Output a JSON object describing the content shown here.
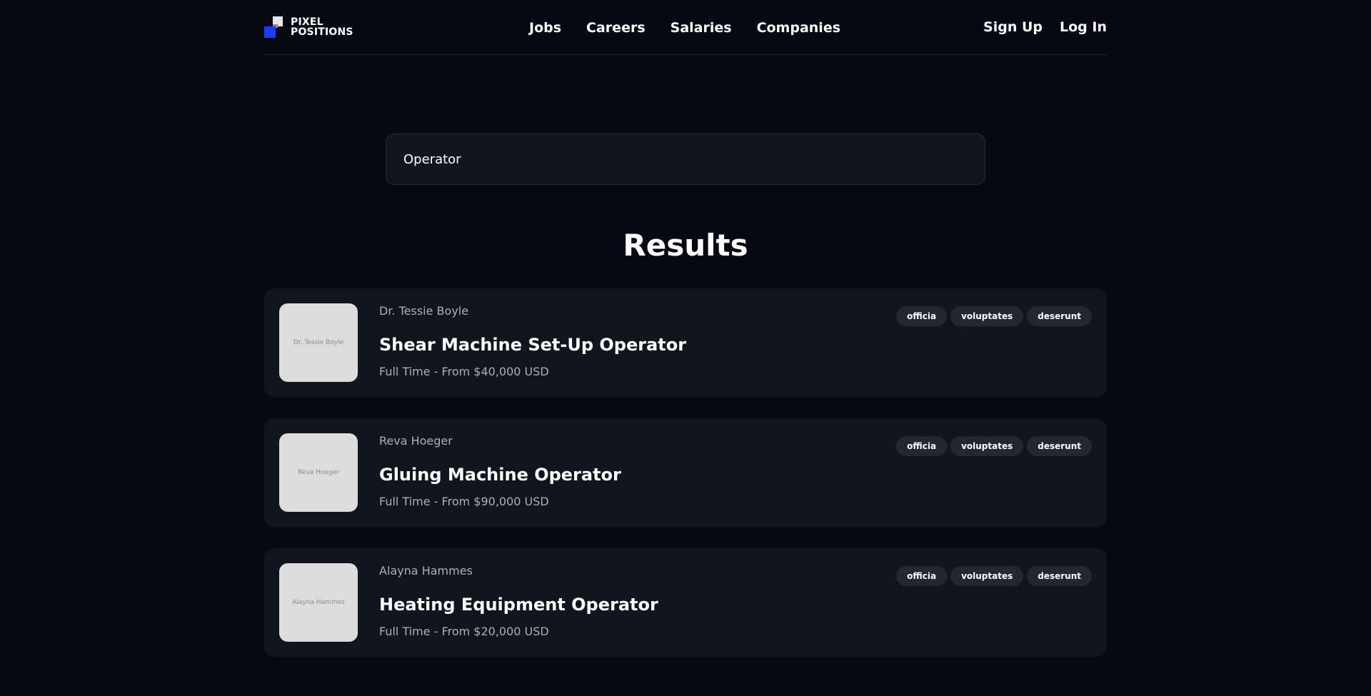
{
  "brand": {
    "line1": "PIXEL",
    "line2": "POSITIONS"
  },
  "nav": {
    "jobs": "Jobs",
    "careers": "Careers",
    "salaries": "Salaries",
    "companies": "Companies"
  },
  "auth": {
    "signup": "Sign Up",
    "login": "Log In"
  },
  "search": {
    "value": "Operator"
  },
  "results_title": "Results",
  "jobs": [
    {
      "employer": "Dr. Tessie Boyle",
      "logo_text": "Dr. Tessie Boyle",
      "title": "Shear Machine Set-Up Operator",
      "meta": "Full Time - From $40,000 USD",
      "tags": [
        "officia",
        "voluptates",
        "deserunt"
      ]
    },
    {
      "employer": "Reva Hoeger",
      "logo_text": "Reva Hoeger",
      "title": "Gluing Machine Operator",
      "meta": "Full Time - From $90,000 USD",
      "tags": [
        "officia",
        "voluptates",
        "deserunt"
      ]
    },
    {
      "employer": "Alayna Hammes",
      "logo_text": "Alayna Hammes",
      "title": "Heating Equipment Operator",
      "meta": "Full Time - From $20,000 USD",
      "tags": [
        "officia",
        "voluptates",
        "deserunt"
      ]
    }
  ],
  "colors": {
    "background": "#060913",
    "card": "#11151e",
    "brand_blue": "#1f3bff",
    "tag": "#232731"
  }
}
